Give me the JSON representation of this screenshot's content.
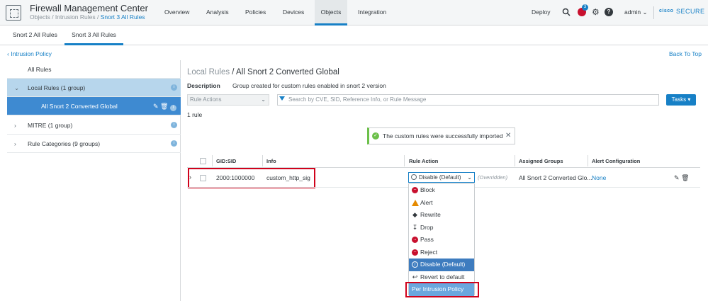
{
  "header": {
    "app_title": "Firewall Management Center",
    "breadcrumb_parts": [
      "Objects",
      "Intrusion Rules"
    ],
    "breadcrumb_sep": " / ",
    "breadcrumb_current": "Snort 3 All Rules",
    "nav": [
      "Overview",
      "Analysis",
      "Policies",
      "Devices",
      "Objects",
      "Integration"
    ],
    "nav_active": "Objects",
    "deploy": "Deploy",
    "alert_count": "3",
    "help_glyph": "?",
    "user": "admin",
    "brand_cisco": "cisco",
    "brand_secure": "SECURE"
  },
  "subtabs": [
    "Snort 2 All Rules",
    "Snort 3 All Rules"
  ],
  "subtab_active": "Snort 3 All Rules",
  "links": {
    "back_policy": "Intrusion Policy",
    "back_top": "Back To Top"
  },
  "tree": {
    "all_rules": "All Rules",
    "local_rules": "Local Rules (1 group)",
    "converted": "All Snort 2 Converted Global",
    "mitre": "MITRE (1 group)",
    "categories": "Rule Categories (9 groups)"
  },
  "main": {
    "title_muted": "Local Rules",
    "title_sep": " / ",
    "title": "All Snort 2 Converted Global",
    "desc_label": "Description",
    "desc_text": "Group created for custom rules enabled in snort 2 version",
    "rule_actions_placeholder": "Rule Actions",
    "search_placeholder": "Search by CVE, SID, Reference Info, or Rule Message",
    "tasks_label": "Tasks ▾",
    "rule_count": "1 rule",
    "toast": "The custom rules were successfully imported"
  },
  "table": {
    "headers": [
      "GID:SID",
      "Info",
      "Rule Action",
      "Assigned Groups",
      "Alert Configuration"
    ],
    "row": {
      "gid_sid": "2000:1000000",
      "info": "custom_http_sig",
      "action": "Disable (Default)",
      "overridden": "(Overridden)",
      "groups": "All Snort 2 Converted Glo...",
      "alert": "None"
    }
  },
  "dropdown": {
    "options": [
      "Block",
      "Alert",
      "Rewrite",
      "Drop",
      "Pass",
      "Reject",
      "Disable (Default)",
      "Revert to default",
      "Per Intrusion Policy"
    ],
    "selected": "Disable (Default)",
    "highlighted": "Per Intrusion Policy"
  },
  "colors": {
    "accent": "#1780c6",
    "highlight_box": "#d0021b",
    "success": "#6cc04a",
    "block": "#c8102e",
    "alert": "#e58a00"
  }
}
